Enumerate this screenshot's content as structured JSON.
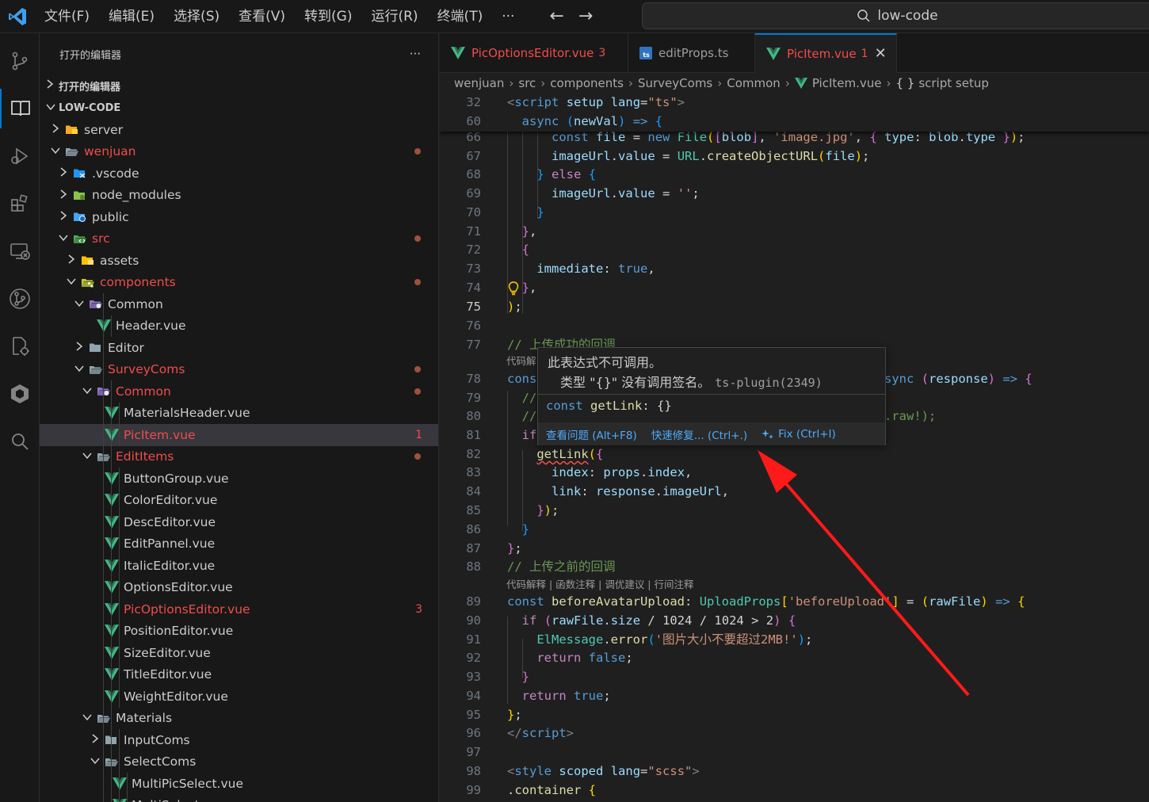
{
  "titlebar": {
    "menu": [
      "文件(F)",
      "编辑(E)",
      "选择(S)",
      "查看(V)",
      "转到(G)",
      "运行(R)",
      "终端(T)",
      "···"
    ],
    "search_text": "low-code"
  },
  "sidebar": {
    "title": "打开的编辑器",
    "more_label": "···",
    "open_editors_label": "打开的编辑器",
    "project_label": "LOW-CODE",
    "tree": [
      {
        "name": "server",
        "depth": 0,
        "type": "folder",
        "expanded": false,
        "icon": "server-folder-icon"
      },
      {
        "name": "wenjuan",
        "depth": 0,
        "type": "folder",
        "expanded": true,
        "modified": true,
        "icon": "folder-icon"
      },
      {
        "name": ".vscode",
        "depth": 1,
        "type": "folder",
        "expanded": false,
        "icon": "vscode-folder-icon"
      },
      {
        "name": "node_modules",
        "depth": 1,
        "type": "folder",
        "expanded": false,
        "icon": "node-folder-icon"
      },
      {
        "name": "public",
        "depth": 1,
        "type": "folder",
        "expanded": false,
        "icon": "public-folder-icon"
      },
      {
        "name": "src",
        "depth": 1,
        "type": "folder",
        "expanded": true,
        "modified": true,
        "icon": "src-folder-icon"
      },
      {
        "name": "assets",
        "depth": 2,
        "type": "folder",
        "expanded": false,
        "icon": "assets-folder-icon"
      },
      {
        "name": "components",
        "depth": 2,
        "type": "folder",
        "expanded": true,
        "modified": true,
        "icon": "components-folder-icon"
      },
      {
        "name": "Common",
        "depth": 3,
        "type": "folder",
        "expanded": true,
        "icon": "common-folder-icon"
      },
      {
        "name": "Header.vue",
        "depth": 4,
        "type": "vue"
      },
      {
        "name": "Editor",
        "depth": 3,
        "type": "folder",
        "expanded": false,
        "icon": "folder-icon"
      },
      {
        "name": "SurveyComs",
        "depth": 3,
        "type": "folder",
        "expanded": true,
        "modified": true,
        "icon": "folder-icon"
      },
      {
        "name": "Common",
        "depth": 4,
        "type": "folder",
        "expanded": true,
        "modified": true,
        "icon": "common-folder-icon"
      },
      {
        "name": "MaterialsHeader.vue",
        "depth": 5,
        "type": "vue"
      },
      {
        "name": "PicItem.vue",
        "depth": 5,
        "type": "vue",
        "selected": true,
        "errors": "1"
      },
      {
        "name": "EditItems",
        "depth": 4,
        "type": "folder",
        "expanded": true,
        "modified": true,
        "icon": "folder-icon"
      },
      {
        "name": "ButtonGroup.vue",
        "depth": 5,
        "type": "vue"
      },
      {
        "name": "ColorEditor.vue",
        "depth": 5,
        "type": "vue"
      },
      {
        "name": "DescEditor.vue",
        "depth": 5,
        "type": "vue"
      },
      {
        "name": "EditPannel.vue",
        "depth": 5,
        "type": "vue"
      },
      {
        "name": "ItalicEditor.vue",
        "depth": 5,
        "type": "vue"
      },
      {
        "name": "OptionsEditor.vue",
        "depth": 5,
        "type": "vue"
      },
      {
        "name": "PicOptionsEditor.vue",
        "depth": 5,
        "type": "vue",
        "errors": "3"
      },
      {
        "name": "PositionEditor.vue",
        "depth": 5,
        "type": "vue"
      },
      {
        "name": "SizeEditor.vue",
        "depth": 5,
        "type": "vue"
      },
      {
        "name": "TitleEditor.vue",
        "depth": 5,
        "type": "vue"
      },
      {
        "name": "WeightEditor.vue",
        "depth": 5,
        "type": "vue"
      },
      {
        "name": "Materials",
        "depth": 4,
        "type": "folder",
        "expanded": true,
        "icon": "folder-icon"
      },
      {
        "name": "InputComs",
        "depth": 5,
        "type": "folder",
        "expanded": false,
        "icon": "folder-icon"
      },
      {
        "name": "SelectComs",
        "depth": 5,
        "type": "folder",
        "expanded": true,
        "icon": "folder-icon"
      },
      {
        "name": "MultiPicSelect.vue",
        "depth": 6,
        "type": "vue"
      },
      {
        "name": "MultiSelect.vue",
        "depth": 6,
        "type": "vue"
      }
    ]
  },
  "tabs": [
    {
      "label": "PicOptionsEditor.vue",
      "count": "3",
      "kind": "vue",
      "state": "error"
    },
    {
      "label": "editProps.ts",
      "count": "",
      "kind": "ts",
      "state": "plain"
    },
    {
      "label": "PicItem.vue",
      "count": "1",
      "kind": "vue",
      "state": "error",
      "active": true,
      "close": "✕"
    }
  ],
  "breadcrumb": [
    "wenjuan",
    "src",
    "components",
    "SurveyComs",
    "Common",
    "PicItem.vue",
    "script setup"
  ],
  "breadcrumb_braces": "{ }",
  "editor": {
    "current_line": "75",
    "lens_text": "代码解释 | 函数注释 | 调优建议 | 行间注释",
    "lens_text_partial": "代码解"
  },
  "hover": {
    "message": "此表达式不可调用。",
    "detail": "类型 \"{}\" 没有调用签名。",
    "source": "ts-plugin(2349)",
    "signature": "const getLink: {}",
    "actions": [
      "查看问题 (Alt+F8)",
      "快速修复... (Ctrl+.)",
      "Fix (Ctrl+I)"
    ]
  },
  "colors": {
    "accent": "#0078d4",
    "error": "#f14c4c",
    "vue": "#41b883",
    "annotation_arrow": "#ff1a1a"
  }
}
